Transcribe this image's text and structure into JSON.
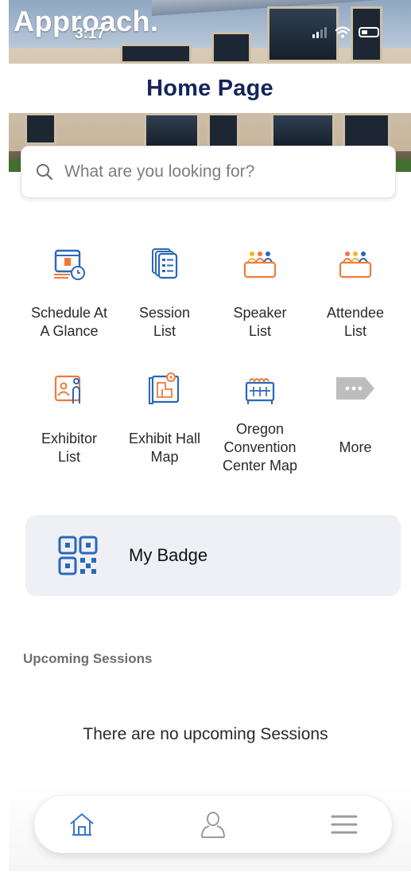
{
  "header": {
    "brand": "Approach.",
    "time": "3:17",
    "title": "Home Page"
  },
  "search": {
    "placeholder": "What are you looking for?"
  },
  "menu": {
    "items": [
      {
        "id": "schedule",
        "label": "Schedule At\nA Glance",
        "icon": "calendar-clock-icon"
      },
      {
        "id": "session-list",
        "label": "Session\nList",
        "icon": "stacked-list-icon"
      },
      {
        "id": "speaker-list",
        "label": "Speaker\nList",
        "icon": "speakers-podium-icon"
      },
      {
        "id": "attendee-list",
        "label": "Attendee\nList",
        "icon": "attendees-group-icon"
      },
      {
        "id": "exhibitor-list",
        "label": "Exhibitor\nList",
        "icon": "exhibitor-booth-icon"
      },
      {
        "id": "exhibit-hall-map",
        "label": "Exhibit Hall\nMap",
        "icon": "floor-map-pin-icon"
      },
      {
        "id": "convention-center-map",
        "label": "Oregon\nConvention\nCenter Map",
        "icon": "convention-center-icon"
      },
      {
        "id": "more",
        "label": "More",
        "icon": "more-tag-icon"
      }
    ]
  },
  "badge_card": {
    "label": "My Badge",
    "icon": "qr-code-icon"
  },
  "upcoming": {
    "heading": "Upcoming Sessions",
    "empty_text": "There are no upcoming Sessions"
  },
  "bottom_nav": [
    {
      "id": "home",
      "icon": "home-icon",
      "active": true
    },
    {
      "id": "profile",
      "icon": "person-icon",
      "active": false
    },
    {
      "id": "menu",
      "icon": "hamburger-menu-icon",
      "active": false
    }
  ],
  "colors": {
    "title_navy": "#15245a",
    "icon_blue": "#2b67b9",
    "icon_orange": "#ee7a3a",
    "icon_gray": "#9b9b9b",
    "nav_active": "#3a78c9",
    "card_bg": "#eff0f5"
  }
}
